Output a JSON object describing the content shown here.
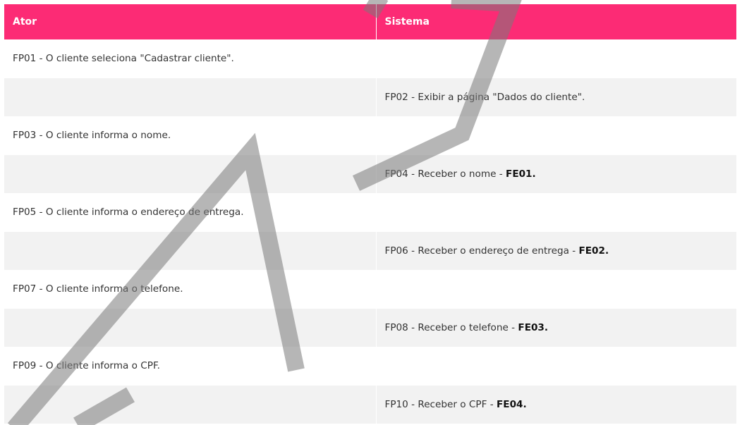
{
  "table": {
    "headers": [
      "Ator",
      "Sistema"
    ],
    "rows": [
      {
        "ator": "FP01 - O cliente seleciona \"Cadastrar cliente\".",
        "sistema": "",
        "sistema_ref": ""
      },
      {
        "ator": "",
        "sistema": "FP02 - Exibir a página \"Dados do cliente\".",
        "sistema_ref": ""
      },
      {
        "ator": "FP03 - O cliente informa o nome.",
        "sistema": "",
        "sistema_ref": ""
      },
      {
        "ator": "",
        "sistema": "FP04 - Receber o nome - ",
        "sistema_ref": "FE01."
      },
      {
        "ator": "FP05 - O cliente informa o endereço de entrega.",
        "sistema": "",
        "sistema_ref": ""
      },
      {
        "ator": "",
        "sistema": "FP06 - Receber o endereço de entrega - ",
        "sistema_ref": "FE02."
      },
      {
        "ator": "FP07 - O cliente informa o telefone.",
        "sistema": "",
        "sistema_ref": ""
      },
      {
        "ator": "",
        "sistema": "FP08 - Receber o telefone - ",
        "sistema_ref": "FE03."
      },
      {
        "ator": "FP09 - O cliente informa o CPF.",
        "sistema": "",
        "sistema_ref": ""
      },
      {
        "ator": "",
        "sistema": "FP10 - Receber o CPF - ",
        "sistema_ref": "FE04."
      }
    ]
  },
  "colors": {
    "header_bg": "#fc2b75",
    "row_alt_bg": "#f2f2f2",
    "watermark": "#8c8c8c"
  }
}
